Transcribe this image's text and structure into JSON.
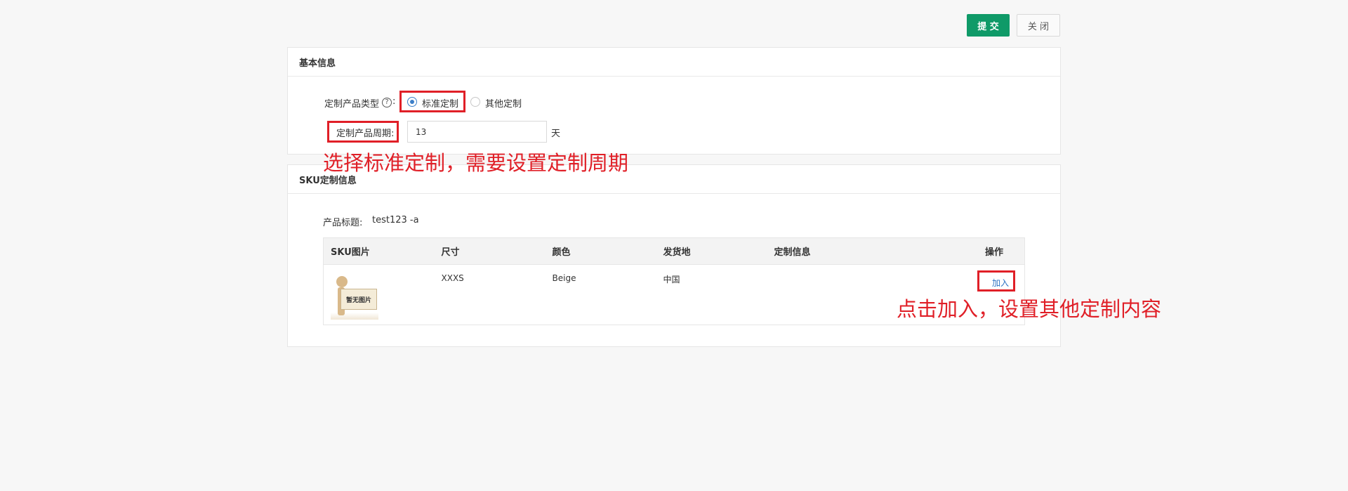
{
  "toolbar": {
    "submit_label": "提 交",
    "close_label": "关 闭"
  },
  "basic_info": {
    "title": "基本信息",
    "product_type_label": "定制产品类型",
    "help_icon": "?",
    "colon": ":",
    "options": [
      "标准定制",
      "其他定制"
    ],
    "selected_option": "标准定制",
    "cycle_label": "定制产品周期:",
    "cycle_value": "13",
    "cycle_unit": "天"
  },
  "sku_info": {
    "title": "SKU定制信息",
    "product_title_label": "产品标题:",
    "product_title_value": "test123 -a",
    "columns": [
      "SKU图片",
      "尺寸",
      "颜色",
      "发货地",
      "定制信息",
      "操作"
    ],
    "rows": [
      {
        "image_text": "暂无图片",
        "size": "XXXS",
        "color": "Beige",
        "origin": "中国",
        "custom_info": "",
        "action": "加入"
      }
    ]
  },
  "annotations": {
    "note1": "选择标准定制，需要设置定制周期",
    "note2": "点击加入，设置其他定制内容",
    "color": "#e01f27"
  },
  "colors": {
    "accent": "#0f9a68",
    "link": "#2d73c4",
    "radio": "#3c7fc8"
  }
}
